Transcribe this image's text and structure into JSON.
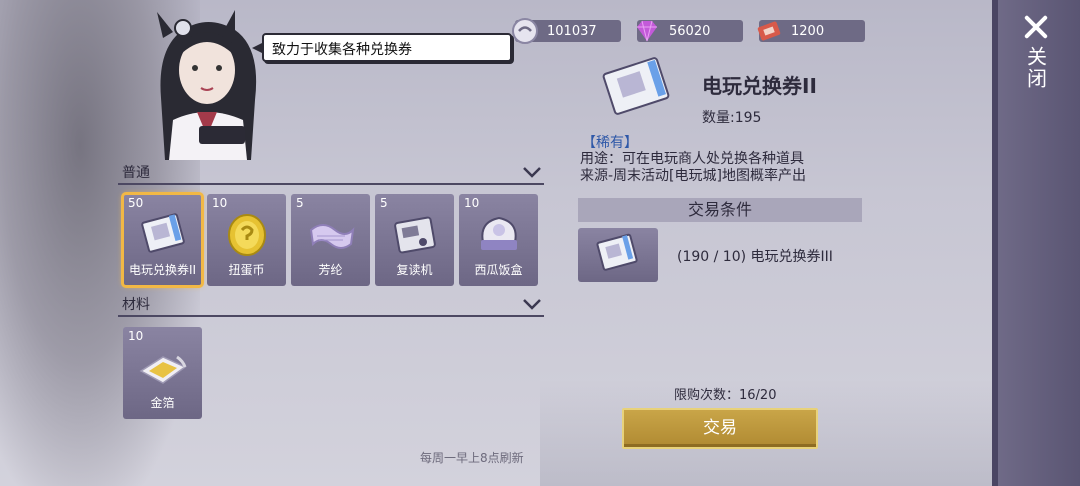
{
  "currencies": [
    {
      "icon": "coin-icon",
      "value": "101037"
    },
    {
      "icon": "diamond-icon",
      "value": "56020"
    },
    {
      "icon": "ticket-icon",
      "value": "1200"
    }
  ],
  "speech": "致力于收集各种兑换券",
  "close_label": "关闭",
  "sections": {
    "normal": {
      "title": "普通",
      "items": [
        {
          "count": "50",
          "name": "电玩兑换券II",
          "icon": "arcade-ticket-icon",
          "selected": true
        },
        {
          "count": "10",
          "name": "扭蛋币",
          "icon": "gacha-coin-icon"
        },
        {
          "count": "5",
          "name": "芳纶",
          "icon": "aramid-fabric-icon"
        },
        {
          "count": "5",
          "name": "复读机",
          "icon": "cassette-player-icon"
        },
        {
          "count": "10",
          "name": "西瓜饭盒",
          "icon": "lunchbox-icon"
        }
      ]
    },
    "materials": {
      "title": "材料",
      "items": [
        {
          "count": "10",
          "name": "金箔",
          "icon": "gold-foil-icon"
        }
      ]
    }
  },
  "detail": {
    "title": "电玩兑换券II",
    "quantity": "数量:195",
    "rarity": "【稀有】",
    "usage": "用途：可在电玩商人处兑换各种道具",
    "source": "来源-周末活动[电玩城]地图概率产出",
    "condition_header": "交易条件",
    "condition_text": "(190 / 10) 电玩兑换券III",
    "limit": "限购次数：16/20",
    "trade_label": "交易"
  },
  "refresh_note": "每周一早上8点刷新",
  "colors": {
    "accent_gold": "#c9a548",
    "tile_purple": "#7a7494",
    "rarity_blue": "#2e58a8"
  }
}
